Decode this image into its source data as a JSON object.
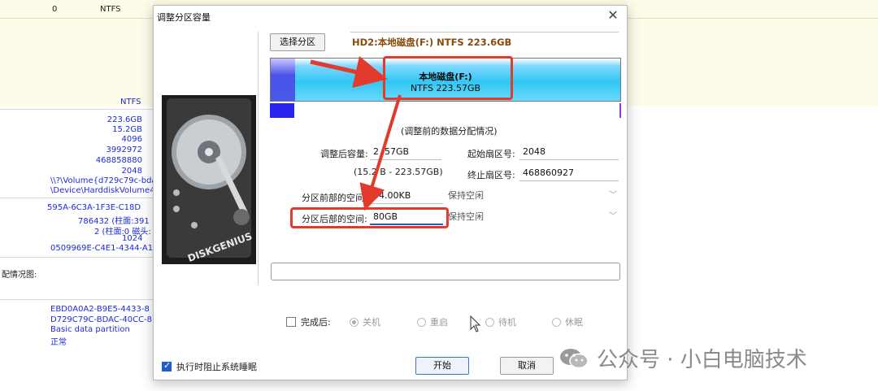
{
  "background": {
    "top_row": {
      "num": "0",
      "fs": "NTFS"
    },
    "mid": {
      "fs": "NTFS",
      "lines": [
        "223.6GB",
        "15.2GB",
        "4096",
        "3992972",
        "468858880",
        "2048",
        "\\\\?\\Volume{d729c79c-bda",
        "\\Device\\HarddiskVolume4"
      ],
      "lines2": [
        "595A-6C3A-1F3E-C18D",
        "786432 (柱面:391",
        "2 (柱面:0 磁头:",
        "1024",
        "0509969E-C4E1-4344-A1"
      ],
      "label": "配情况图:",
      "lines3": [
        "EBD0A0A2-B9E5-4433-8",
        "D729C79C-BDAC-40CC-8",
        "Basic data partition",
        "正常"
      ]
    }
  },
  "dialog": {
    "title": "调整分区容量",
    "close_glyph": "✕",
    "select_partition_label": "选择分区",
    "disk_label": "HD2:本地磁盘(F:) NTFS 223.6GB",
    "partition": {
      "name": "本地磁盘(F:)",
      "size": "NTFS 223.57GB"
    },
    "caption": "(调整前的数据分配情况)",
    "fields": {
      "resized_label": "调整后容量:",
      "resized_value": "2 .57GB",
      "range": "(15.2 B - 223.57GB)",
      "start_sector_label": "起始扇区号:",
      "start_sector_value": "2048",
      "end_sector_label": "终止扇区号:",
      "end_sector_value": "468860927",
      "before_space_label": "分区前部的空间:",
      "before_space_value": "04.00KB",
      "before_space_option": "保持空闲",
      "after_space_label": "分区后部的空间:",
      "after_space_value": "80GB",
      "after_space_option": "保持空闲"
    },
    "after_complete": {
      "label": "完成后:",
      "options": [
        "关机",
        "重启",
        "待机",
        "休眠"
      ]
    },
    "prevent_sleep_label": "执行时阻止系统睡眠",
    "start_label": "开始",
    "cancel_label": "取消"
  },
  "watermark": {
    "text": "公众号 · 小白电脑技术",
    "icon": "wechat-icon"
  },
  "colors": {
    "annotation": "#e23b2e",
    "partition_fill": "#31c6f3",
    "used_space": "#2823f0",
    "disk_label": "#8a4a0a",
    "background_text": "#1b2bd6"
  }
}
